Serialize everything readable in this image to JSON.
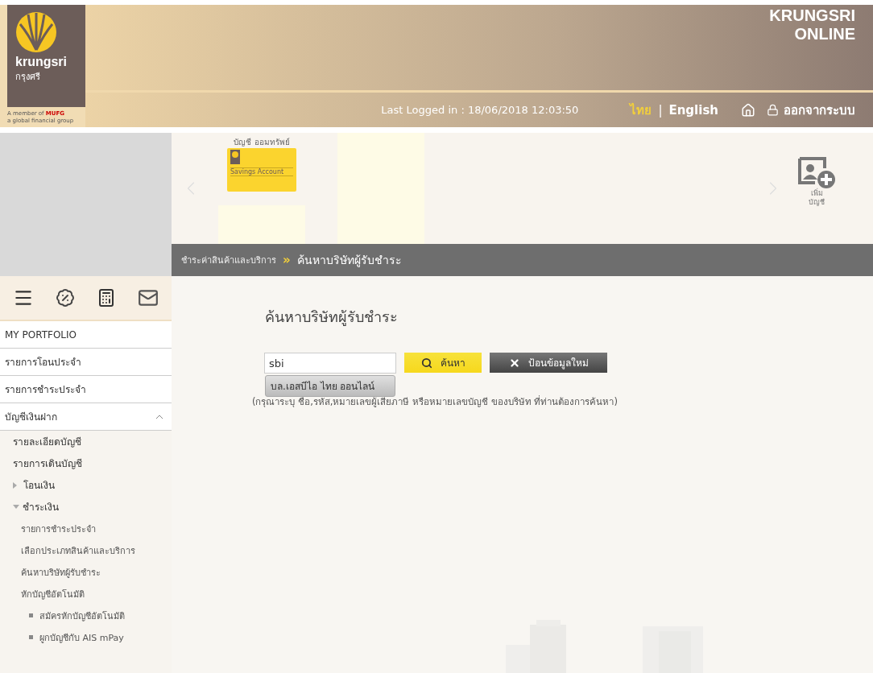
{
  "header": {
    "logo": {
      "name": "krungsri",
      "thai_name": "กรุงศรี",
      "member_of": "A member of",
      "group": "MUFG",
      "tagline": "a global financial group"
    },
    "title": [
      "KRUNGSRI",
      "ONLINE"
    ],
    "last_logged": "Last Logged in : 18/06/2018 12:03:50",
    "languages": [
      {
        "label": "ไทย",
        "selected": true
      },
      {
        "label": "English",
        "selected": false
      }
    ],
    "lang_separator": "|",
    "logout": "ออกจากระบบ"
  },
  "accounts": {
    "cards": [
      {
        "label": "บัญชี ออมทรัพย์",
        "card_text": "Savings Account"
      }
    ],
    "add_label": "เพิ่ม บัญชี"
  },
  "breadcrumb": {
    "items": [
      "ชำระค่าสินค้าและบริการ",
      "ค้นหาบริษัทผู้รับชำระ"
    ],
    "separator": "»"
  },
  "sidebar": {
    "items": [
      {
        "label": "MY PORTFOLIO"
      },
      {
        "label": "รายการโอนประจำ"
      },
      {
        "label": "รายการชำระประจำ"
      },
      {
        "label": "บัญชีเงินฝาก",
        "expanded": true,
        "children": [
          {
            "label": "รายละเอียดบัญชี"
          },
          {
            "label": "รายการเดินบัญชี"
          },
          {
            "label": "โอนเงิน",
            "expanded": false
          },
          {
            "label": "ชำระเงิน",
            "expanded": true,
            "children": [
              {
                "label": "รายการชำระประจำ"
              },
              {
                "label": "เลือกประเภทสินค้าและบริการ"
              },
              {
                "label": "ค้นหาบริษัทผู้รับชำระ"
              },
              {
                "label": "หักบัญชีอัตโนมัติ",
                "children": [
                  {
                    "label": "สมัครหักบัญชีอัตโนมัติ"
                  },
                  {
                    "label": "ผูกบัญชีกับ AIS mPay"
                  }
                ]
              }
            ]
          }
        ]
      }
    ]
  },
  "search": {
    "heading": "ค้นหาบริษัทผู้รับชำระ",
    "value": "sbi",
    "suggestion": "บล.เอสบีไอ ไทย ออนไลน์",
    "search_button": "ค้นหา",
    "reset_button": "ป้อนข้อมูลใหม่",
    "hint": "(กรุณาระบุ ชื่อ,รหัส,หมายเลขผู้เสียภาษี หรือหมายเลขบัญชี ของบริษัท ที่ท่านต้องการค้นหา)"
  }
}
